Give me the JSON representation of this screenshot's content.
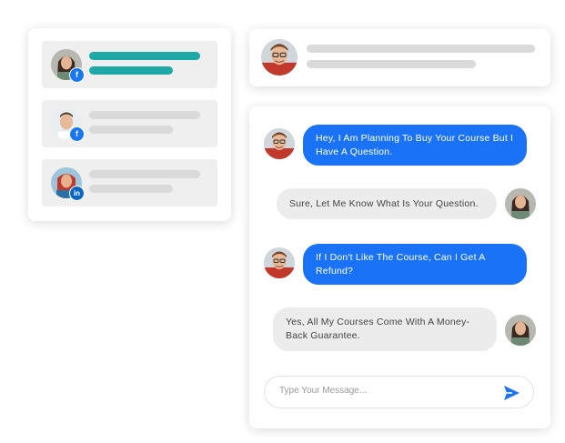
{
  "colors": {
    "accent": "#1a73f6",
    "teal": "#1fa9a6",
    "facebook": "#1877f2",
    "linkedin": "#0a66c2",
    "incoming_bubble": "#ececec"
  },
  "contacts": [
    {
      "social_icon": "facebook-icon",
      "social_glyph": "f",
      "selected": true
    },
    {
      "social_icon": "facebook-icon",
      "social_glyph": "f",
      "selected": false
    },
    {
      "social_icon": "linkedin-icon",
      "social_glyph": "in",
      "selected": false
    }
  ],
  "messages": [
    {
      "direction": "out",
      "text": "Hey, I Am Planning To Buy Your Course But I Have A Question."
    },
    {
      "direction": "in",
      "text": "Sure, Let Me Know What Is Your Question."
    },
    {
      "direction": "out",
      "text": "If I Don't Like The Course, Can I Get A Refund?"
    },
    {
      "direction": "in",
      "text": "Yes, All My Courses Come With A Money-Back Guarantee."
    }
  ],
  "composer": {
    "placeholder": "Type Your Message...",
    "value": "",
    "send_icon": "send-icon"
  }
}
